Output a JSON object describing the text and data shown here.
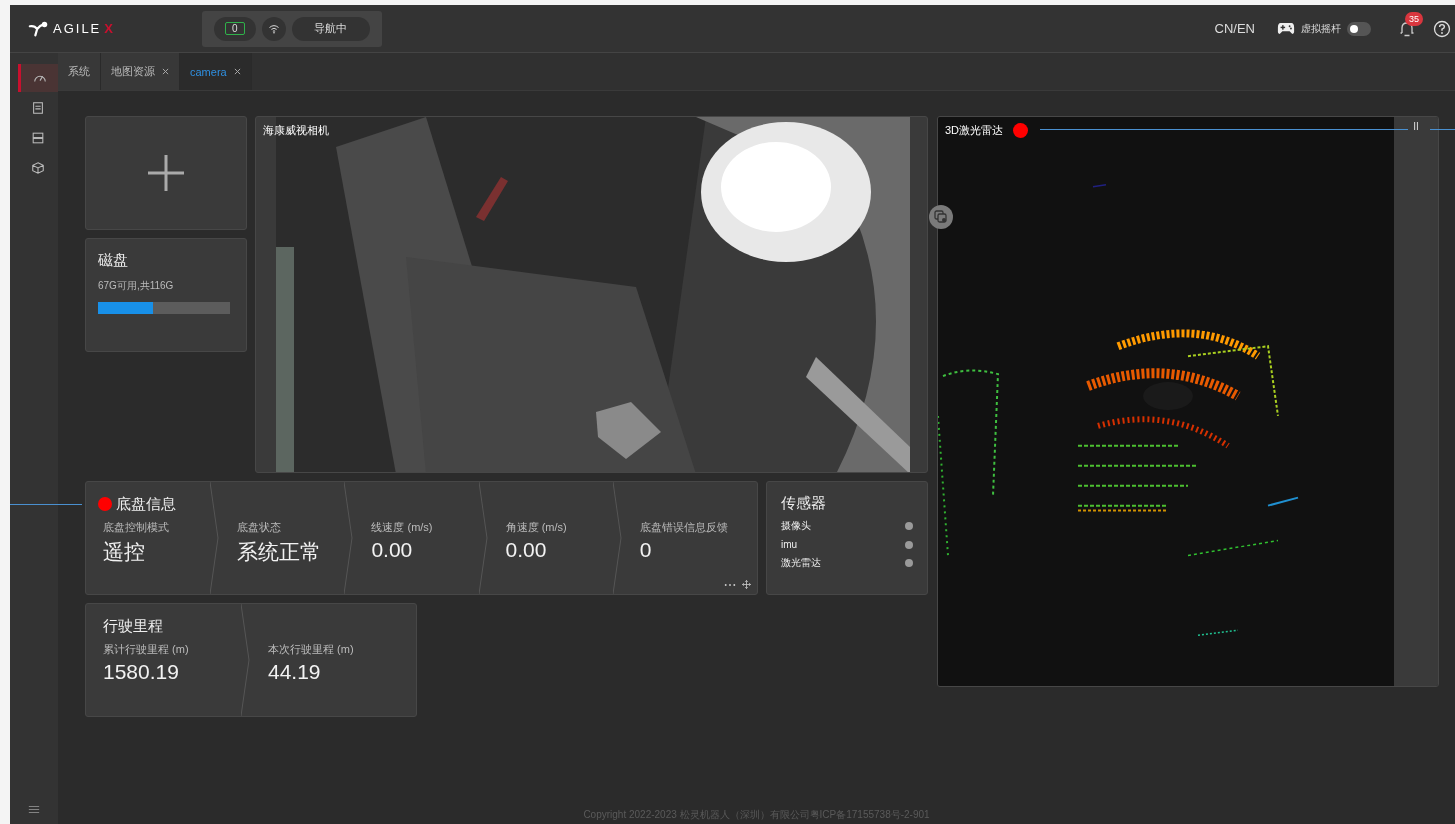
{
  "header": {
    "logo": {
      "text": "AGILE",
      "accent": "X"
    },
    "battery": "0",
    "nav_status": "导航中",
    "language": "CN/EN",
    "joystick": {
      "label": "虚拟摇杆",
      "on": false
    },
    "notifications": "35"
  },
  "sidebar": {
    "items": [
      {
        "selected": true
      },
      {
        "selected": false
      },
      {
        "selected": false
      },
      {
        "selected": false
      }
    ]
  },
  "tabs": [
    {
      "label": "系统",
      "closable": false,
      "selected": false
    },
    {
      "label": "地图资源",
      "closable": true,
      "selected": false
    },
    {
      "label": "camera",
      "closable": true,
      "selected": true
    }
  ],
  "disk": {
    "title": "磁盘",
    "text": "67G可用,共116G",
    "level": 0.42
  },
  "camera": {
    "title": "海康威视相机",
    "kind": "picture"
  },
  "chassis": {
    "title": "底盘信息",
    "fields": [
      {
        "label": "底盘控制模式",
        "value": "遥控"
      },
      {
        "label": "底盘状态",
        "value": "系统正常"
      },
      {
        "label": "线速度 (m/s)",
        "value": "0.00"
      },
      {
        "label": "角速度 (m/s)",
        "value": "0.00"
      },
      {
        "label": "底盘错误信息反馈",
        "value": "0"
      }
    ]
  },
  "sensors": {
    "title": "传感器",
    "items": [
      {
        "name": "摄像头",
        "color": "#9a9a9a"
      },
      {
        "name": "imu",
        "color": "#9a9a9a"
      },
      {
        "name": "激光雷达",
        "color": "#9a9a9a"
      }
    ]
  },
  "mileage": {
    "title": "行驶里程",
    "fields": [
      {
        "label": "累计行驶里程 (m)",
        "value": "1580.19"
      },
      {
        "label": "本次行驶里程 (m)",
        "value": "44.19"
      }
    ]
  },
  "lidar": {
    "title": "3D激光雷达",
    "pause": "II",
    "kind": "picture"
  },
  "footer": "Copyright 2022-2023 松灵机器人（深圳）有限公司粤ICP备17155738号-2-901"
}
